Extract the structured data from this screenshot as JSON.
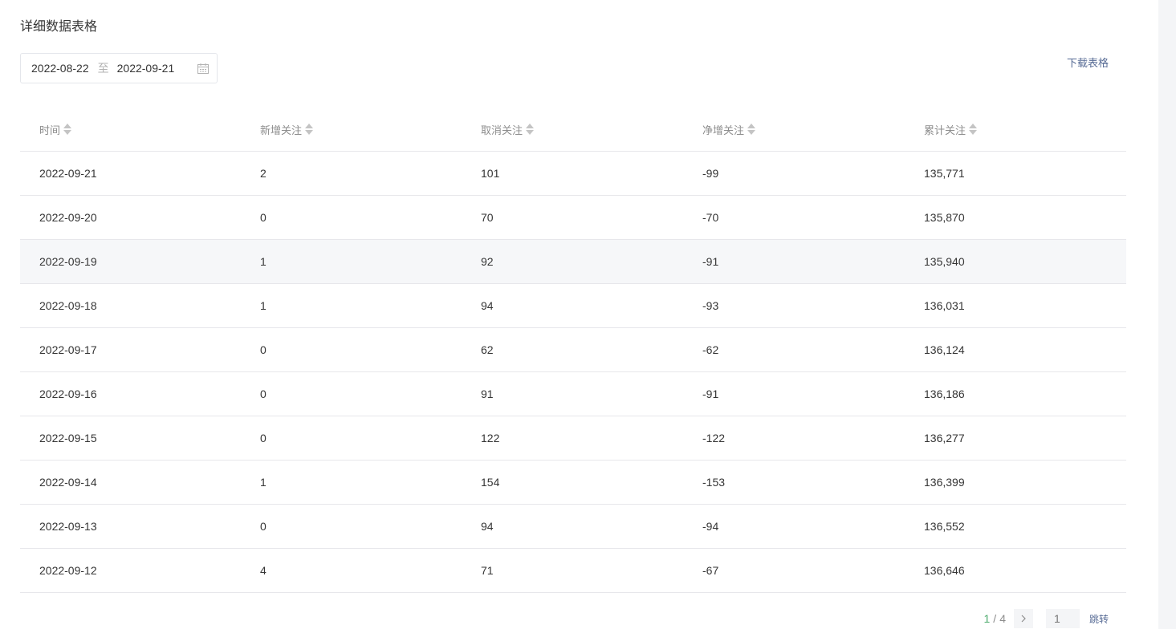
{
  "section": {
    "title": "详细数据表格"
  },
  "date_range": {
    "start": "2022-08-22",
    "separator": "至",
    "end": "2022-09-21"
  },
  "download": {
    "label": "下载表格"
  },
  "table": {
    "columns": [
      "时间",
      "新增关注",
      "取消关注",
      "净增关注",
      "累计关注"
    ],
    "rows": [
      [
        "2022-09-21",
        "2",
        "101",
        "-99",
        "135,771"
      ],
      [
        "2022-09-20",
        "0",
        "70",
        "-70",
        "135,870"
      ],
      [
        "2022-09-19",
        "1",
        "92",
        "-91",
        "135,940"
      ],
      [
        "2022-09-18",
        "1",
        "94",
        "-93",
        "136,031"
      ],
      [
        "2022-09-17",
        "0",
        "62",
        "-62",
        "136,124"
      ],
      [
        "2022-09-16",
        "0",
        "91",
        "-91",
        "136,186"
      ],
      [
        "2022-09-15",
        "0",
        "122",
        "-122",
        "136,277"
      ],
      [
        "2022-09-14",
        "1",
        "154",
        "-153",
        "136,399"
      ],
      [
        "2022-09-13",
        "0",
        "94",
        "-94",
        "136,552"
      ],
      [
        "2022-09-12",
        "4",
        "71",
        "-67",
        "136,646"
      ]
    ],
    "hover_row_index": 2
  },
  "pagination": {
    "current": "1",
    "separator": "/",
    "total": "4",
    "input_placeholder": "1",
    "jump_label": "跳转"
  },
  "colors": {
    "accent_green": "#4dab6d",
    "link_blue": "#576b95",
    "border": "#e7e7eb",
    "hover_row": "#f6f7f9"
  },
  "icons": {
    "calendar": "calendar-icon",
    "sort": "sort-icon",
    "next": "chevron-right-icon"
  }
}
